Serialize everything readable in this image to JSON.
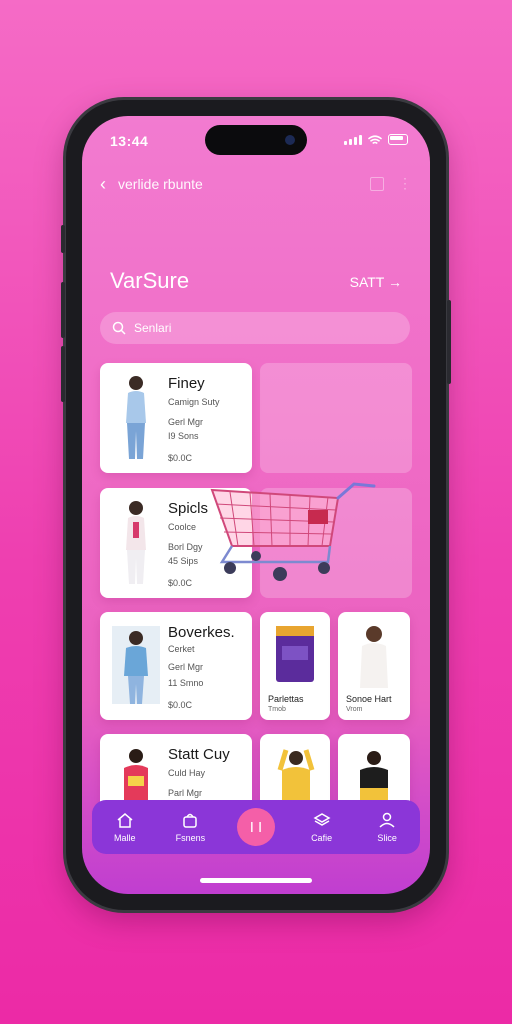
{
  "status": {
    "time": "13:44"
  },
  "nav": {
    "title": "verlide rbunte"
  },
  "brand": "VarSure",
  "sort_label": "SATT →",
  "search": {
    "placeholder": "Senlari"
  },
  "cards": [
    {
      "title": "Finey",
      "line1": "Camign Suty",
      "line2": "Gerl Mgr",
      "line3": "I9 Sons",
      "price": "$0.0C"
    },
    {
      "title": "Spicls",
      "line1": "Coolce",
      "line2": "Borl Dgy",
      "line3": "45 Sips",
      "price": "$0.0C"
    },
    {
      "title": "Boverkes.",
      "line1": "Cerket",
      "line2": "Gerl Mgr",
      "line3": "11 Smno",
      "price": "$0.0C"
    },
    {
      "title": "Statt Cuy",
      "line1": "Culd Hay",
      "line2": "Parl Mgr",
      "line3": "",
      "price": ""
    }
  ],
  "small_cards": [
    {
      "caption": "Parlettas",
      "sub": "Tmob"
    },
    {
      "caption": "Sonoe Hart",
      "sub": "Vrom"
    }
  ],
  "tabbar": {
    "items": [
      {
        "label": "Malle",
        "icon": "home-icon"
      },
      {
        "label": "Fsnens",
        "icon": "bag-icon"
      },
      {
        "label": "I I",
        "icon": "center-icon"
      },
      {
        "label": "Cafie",
        "icon": "stack-icon"
      },
      {
        "label": "Slice",
        "icon": "person-icon"
      }
    ]
  },
  "colors": {
    "accent": "#8b36d8",
    "pink": "#f06cc6",
    "center": "#f45fa8"
  }
}
